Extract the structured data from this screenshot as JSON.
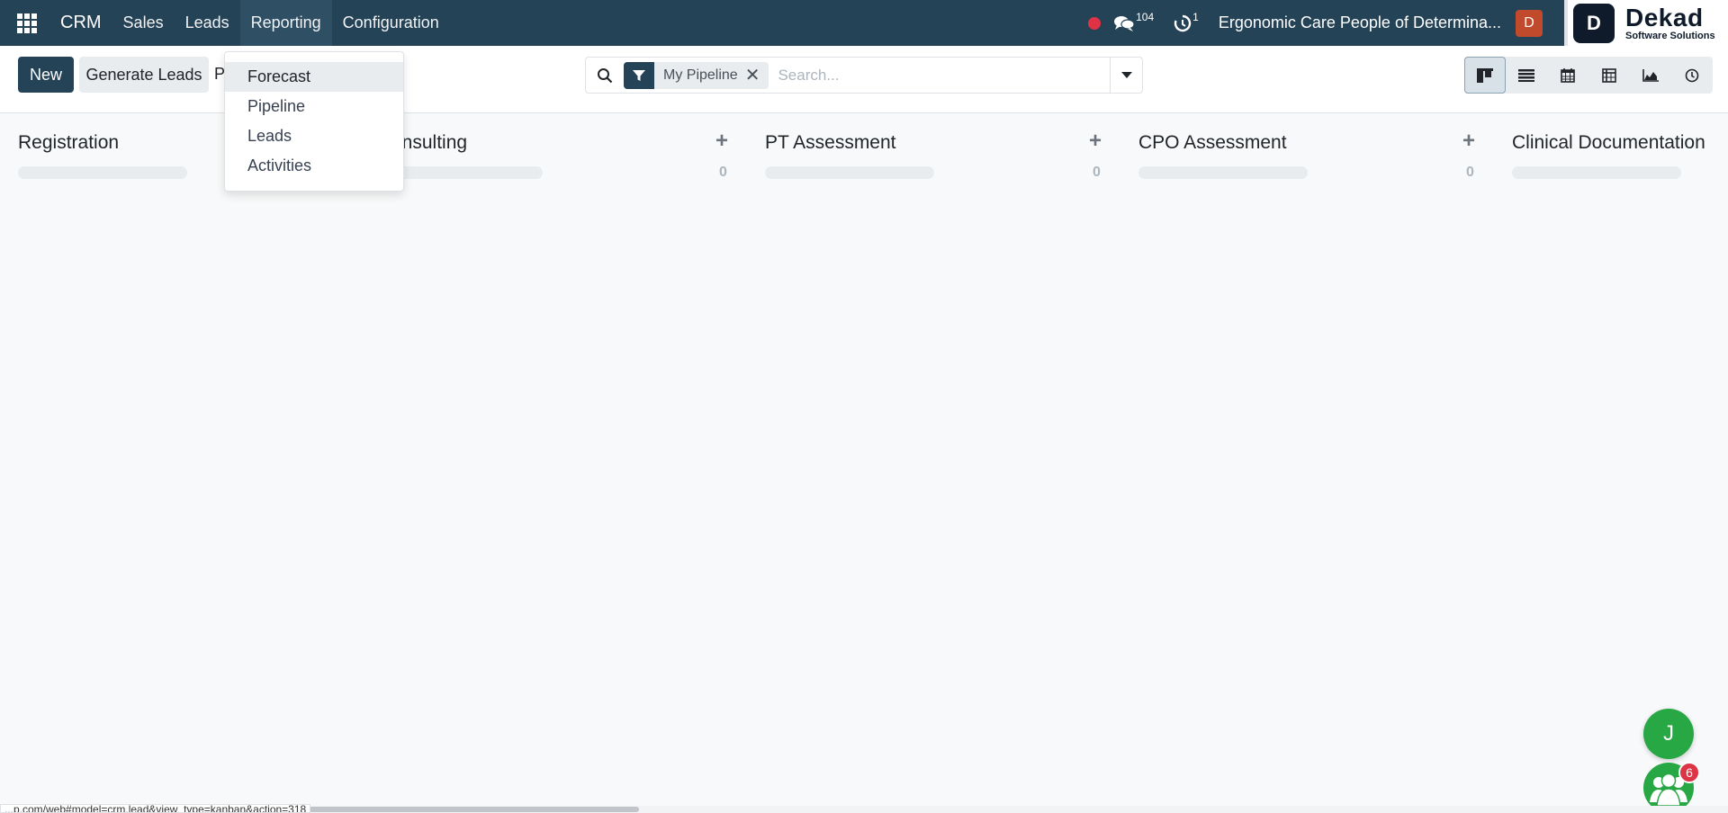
{
  "navbar": {
    "brand": "CRM",
    "items": [
      {
        "label": "Sales"
      },
      {
        "label": "Leads"
      },
      {
        "label": "Reporting"
      },
      {
        "label": "Configuration"
      }
    ],
    "messages_count": "104",
    "activities_count": "1",
    "company": "Ergonomic Care People of Determina...",
    "avatar_initial": "D",
    "logo_mark": "D",
    "logo_title": "Dekad",
    "logo_subtitle": "Software Solutions"
  },
  "control": {
    "new_label": "New",
    "generate_label": "Generate Leads",
    "breadcrumb_partial": "P",
    "search": {
      "facet_label": "My Pipeline",
      "placeholder": "Search..."
    }
  },
  "reporting_menu": {
    "items": [
      {
        "label": "Forecast"
      },
      {
        "label": "Pipeline"
      },
      {
        "label": "Leads"
      },
      {
        "label": "Activities"
      }
    ]
  },
  "kanban": {
    "columns": [
      {
        "title": "Registration"
      },
      {
        "title": "onsulting",
        "count": "0"
      },
      {
        "title": "PT Assessment",
        "count": "0"
      },
      {
        "title": "CPO Assessment",
        "count": "0"
      },
      {
        "title": "Clinical Documentation"
      }
    ]
  },
  "floating": {
    "user_initial": "J",
    "chat_badge": "6"
  },
  "status_url": "...p.com/web#model=crm.lead&view_type=kanban&action=318",
  "colors": {
    "navbar": "#254357",
    "primary": "#254357",
    "accent_green": "#28a745",
    "record_red": "#e03245",
    "avatar": "#c24a2c"
  }
}
